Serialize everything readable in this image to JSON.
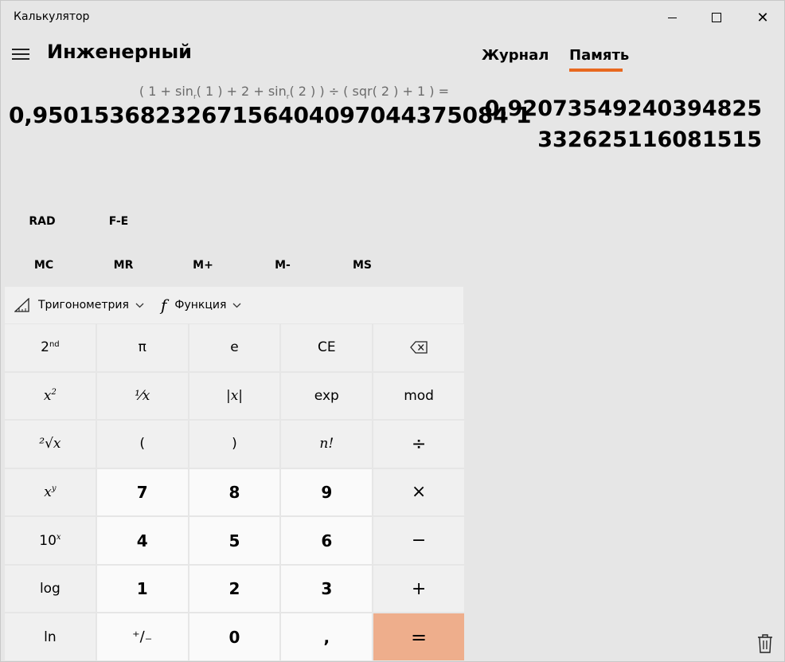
{
  "window": {
    "title": "Калькулятор",
    "controls": {
      "minimize": "",
      "maximize": "",
      "close": "✕"
    }
  },
  "header": {
    "mode": "Инженерный"
  },
  "display": {
    "expression_parts": [
      "( 1 + sin",
      "r",
      "( 1 ) + 2 + sin",
      "r",
      "( 2 ) ) ÷ ( sqr( 2 ) + 1 ) ="
    ],
    "result": "0,9501536823267156404097044375084 1"
  },
  "angle_row": {
    "rad": "RAD",
    "fe": "F-E"
  },
  "memory_row": {
    "mc": "MC",
    "mr": "MR",
    "mplus": "M+",
    "mminus": "M-",
    "ms": "MS"
  },
  "function_bar": {
    "trig": {
      "label": "Тригонометрия",
      "icon": "triangle-ruler-icon"
    },
    "func": {
      "label": "Функция",
      "icon": "function-icon"
    }
  },
  "keypad": {
    "second": {
      "base": "2",
      "sup": "nd"
    },
    "pi": "π",
    "e": "e",
    "ce": "CE",
    "backspace_icon": "⌫",
    "square": {
      "base": "x",
      "sup": "2"
    },
    "reciprocal": "¹⁄x",
    "abs": "|x|",
    "exp": "exp",
    "mod": "mod",
    "root": "²√x",
    "lparen": "(",
    "rparen": ")",
    "factorial": "n!",
    "divide": "÷",
    "power": {
      "base": "x",
      "sup": "y"
    },
    "n7": "7",
    "n8": "8",
    "n9": "9",
    "multiply": "×",
    "ten_power": {
      "base": "10",
      "sup": "x"
    },
    "n4": "4",
    "n5": "5",
    "n6": "6",
    "minus": "−",
    "log": "log",
    "n1": "1",
    "n2": "2",
    "n3": "3",
    "plus": "+",
    "ln": "ln",
    "negate": "⁺∕₋",
    "n0": "0",
    "decimal": ",",
    "equals": "="
  },
  "panel": {
    "tabs": [
      "Журнал",
      "Память"
    ],
    "active_tab": "Память",
    "memory_value": "0,92073549240394825332625116081515"
  },
  "colors": {
    "accent": "#e8681f",
    "equals_bg": "#eeae8c",
    "background": "#e6e6e6",
    "key_bg": "#f0f0f0",
    "num_key_bg": "#fafafa"
  }
}
